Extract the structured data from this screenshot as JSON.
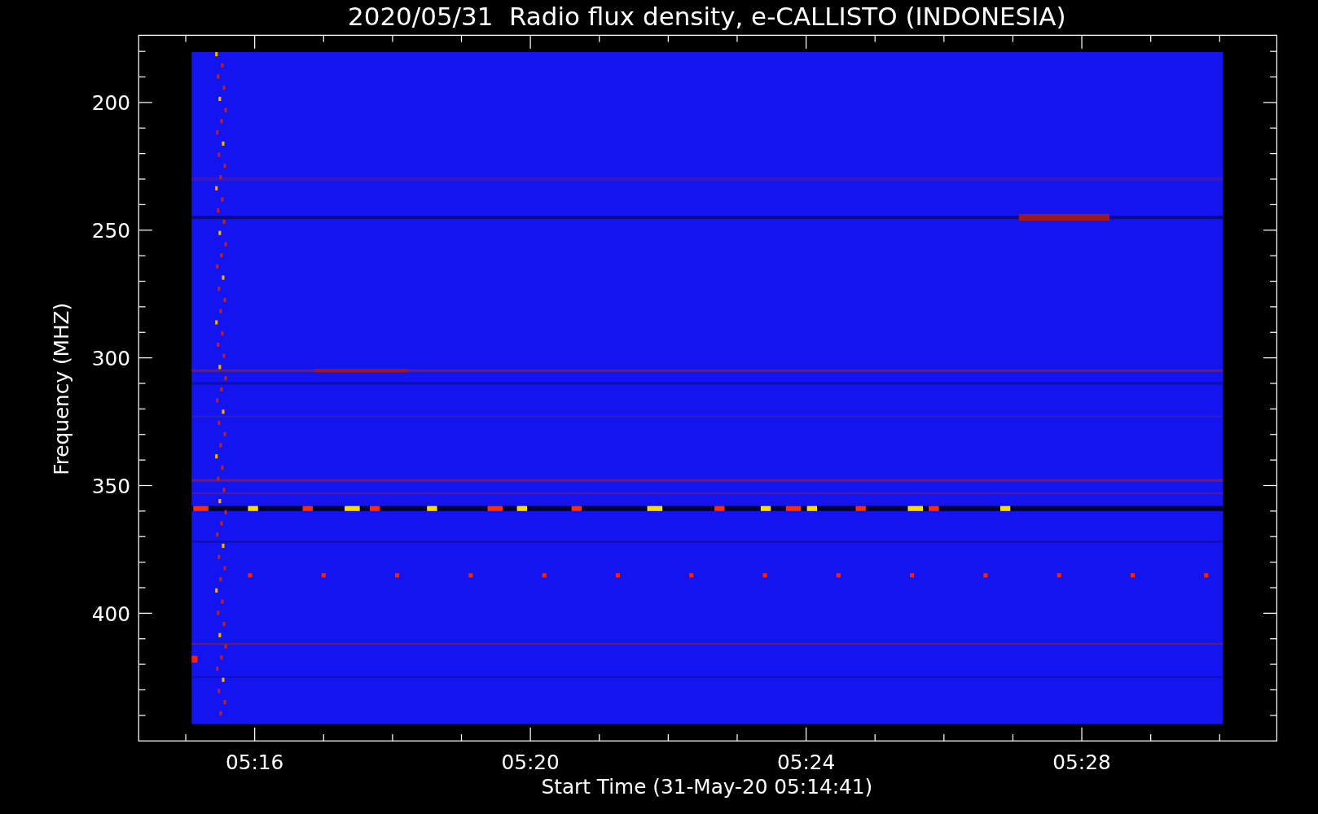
{
  "title": "2020/05/31  Radio flux density, e-CALLISTO (INDONESIA)",
  "plot": {
    "xlabel": "Start Time (31-May-20 05:14:41)",
    "ylabel": "Frequency (MHZ)",
    "xticks": [
      "05:16",
      "05:20",
      "05:24",
      "05:28"
    ],
    "yticks": [
      "200",
      "250",
      "300",
      "350",
      "400"
    ]
  }
}
